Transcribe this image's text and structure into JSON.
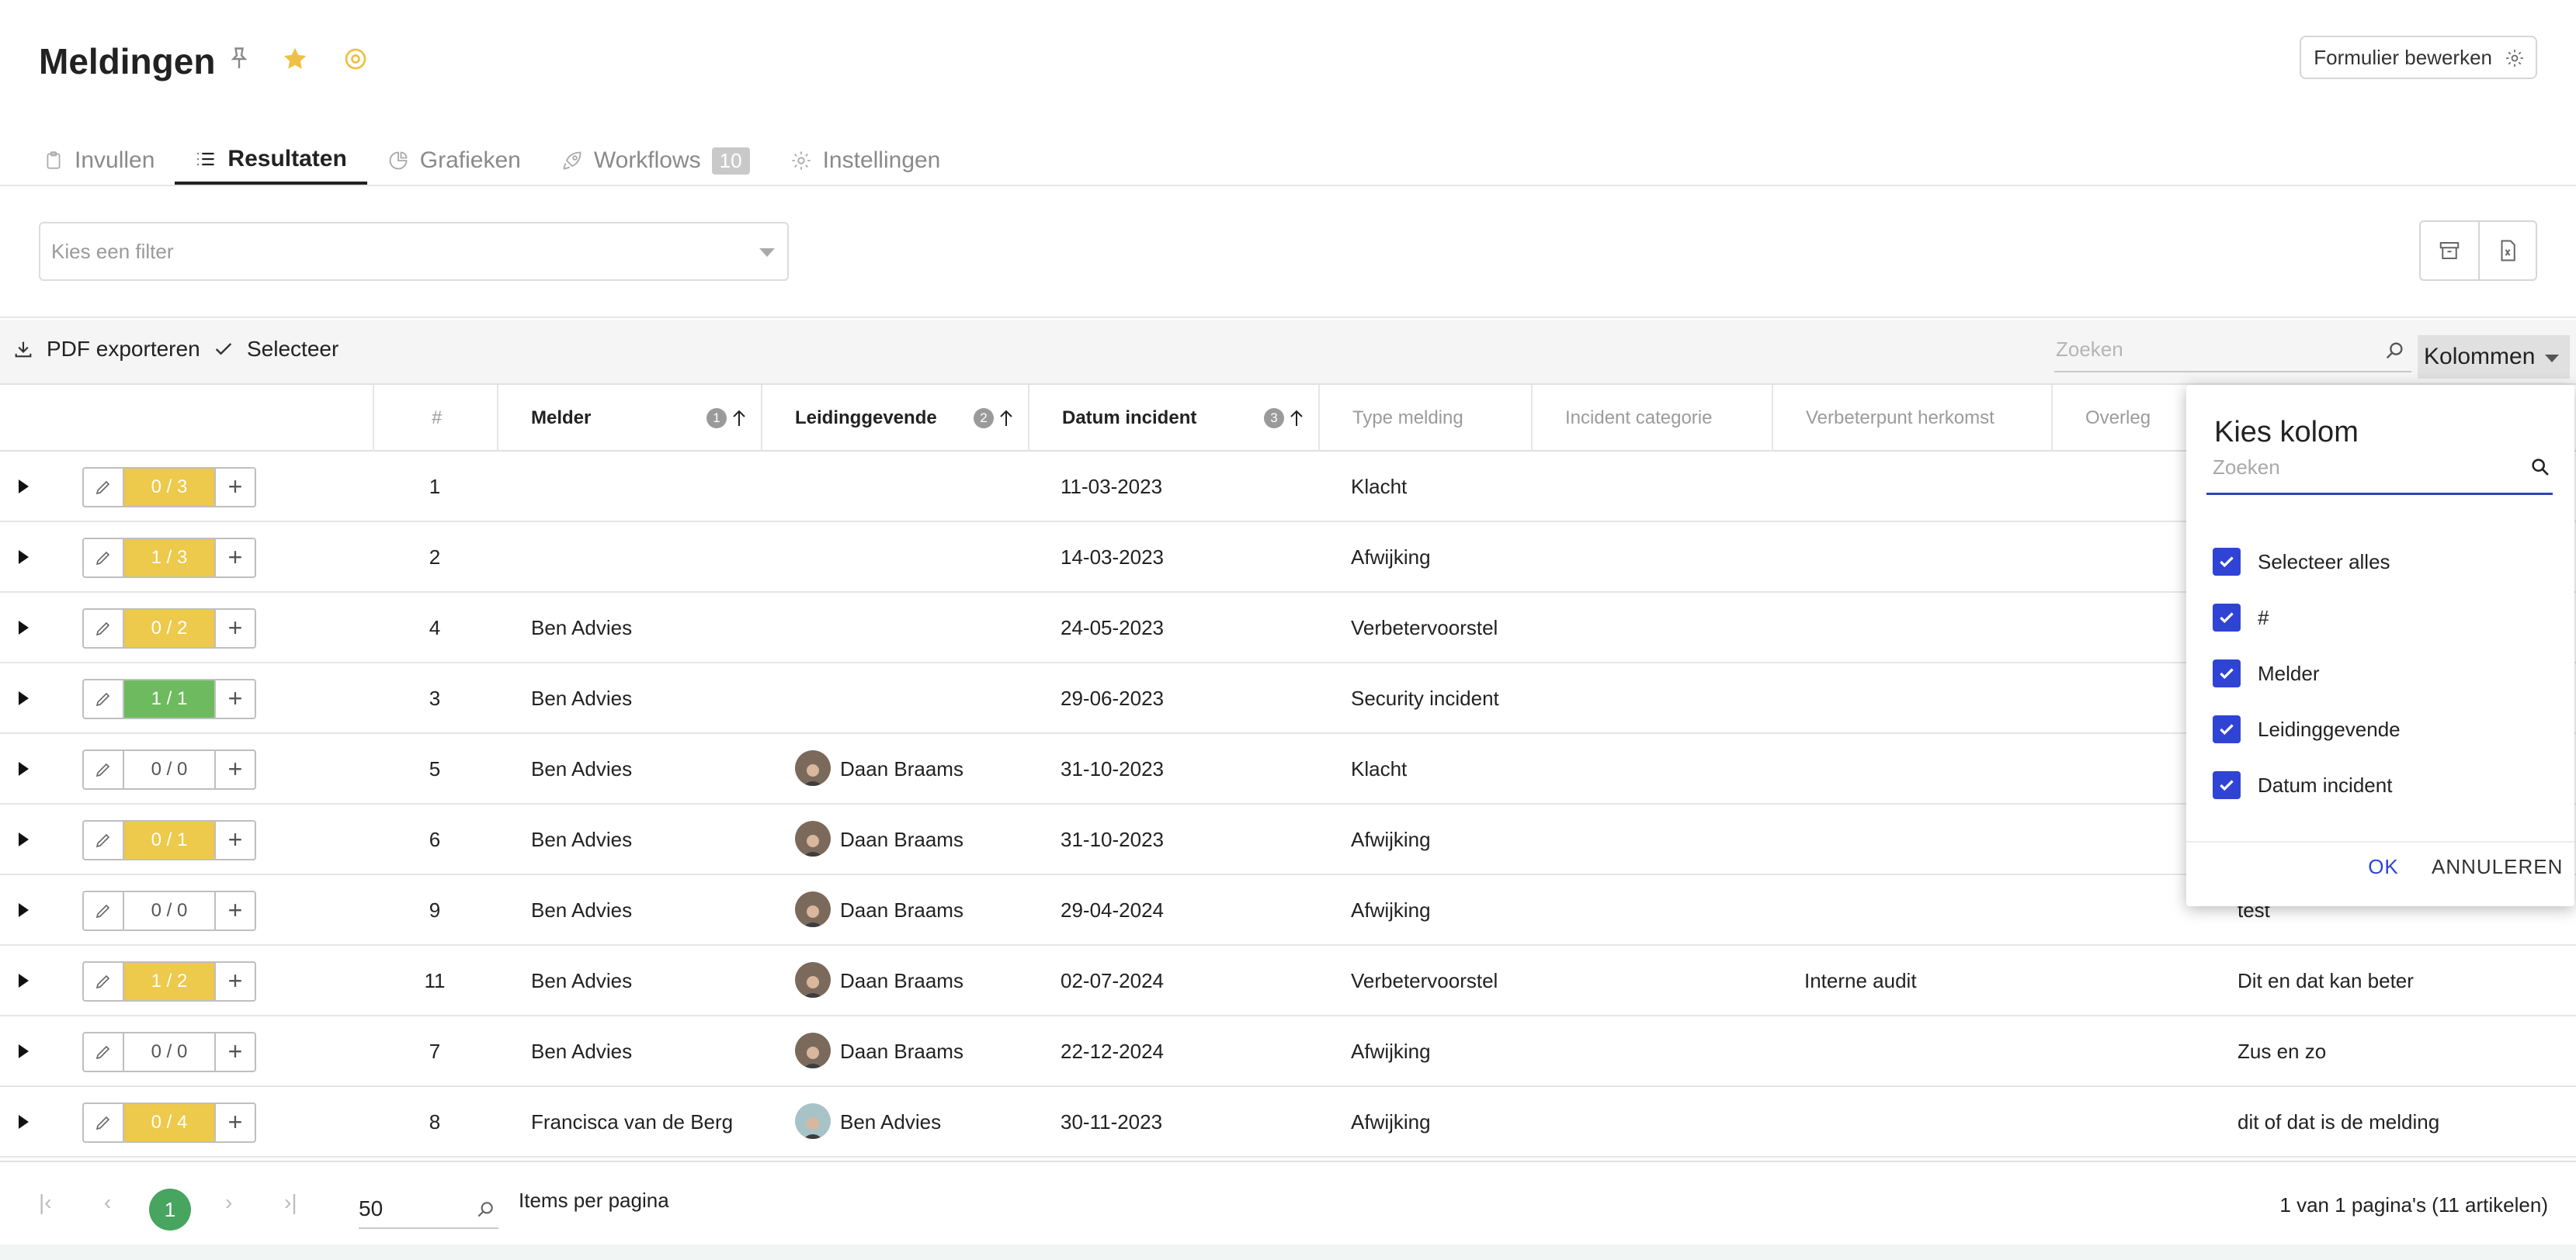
{
  "header": {
    "title": "Meldingen",
    "edit_form_label": "Formulier bewerken"
  },
  "tabs": [
    {
      "label": "Invullen",
      "icon": "clipboard-icon"
    },
    {
      "label": "Resultaten",
      "icon": "list-icon",
      "active": true
    },
    {
      "label": "Grafieken",
      "icon": "pie-chart-icon"
    },
    {
      "label": "Workflows",
      "icon": "rocket-icon",
      "badge": "10"
    },
    {
      "label": "Instellingen",
      "icon": "gear-icon"
    }
  ],
  "filter": {
    "placeholder": "Kies een filter"
  },
  "toolbar": {
    "pdf_label": "PDF exporteren",
    "select_label": "Selecteer",
    "search_placeholder": "Zoeken",
    "columns_label": "Kolommen"
  },
  "columns": [
    "#",
    "Melder",
    "Leidinggevende",
    "Datum incident",
    "Type melding",
    "Incident categorie",
    "Verbeterpunt herkomst",
    "Overleg"
  ],
  "sort": {
    "melder": "1",
    "leidinggevende": "2",
    "datum": "3"
  },
  "rows": [
    {
      "count": "0 / 3",
      "status": "yellow",
      "nr": "1",
      "melder": "",
      "leiding": "",
      "datum": "11-03-2023",
      "type": "Klacht",
      "herkomst": "",
      "extra": ""
    },
    {
      "count": "1 / 3",
      "status": "yellow",
      "nr": "2",
      "melder": "",
      "leiding": "",
      "datum": "14-03-2023",
      "type": "Afwijking",
      "herkomst": "",
      "extra": ""
    },
    {
      "count": "0 / 2",
      "status": "yellow",
      "nr": "4",
      "melder": "Ben Advies",
      "leiding": "",
      "datum": "24-05-2023",
      "type": "Verbetervoorstel",
      "herkomst": "",
      "extra": ""
    },
    {
      "count": "1 / 1",
      "status": "green",
      "nr": "3",
      "melder": "Ben Advies",
      "leiding": "",
      "datum": "29-06-2023",
      "type": "Security incident",
      "herkomst": "",
      "extra": ""
    },
    {
      "count": "0 / 0",
      "status": "none",
      "nr": "5",
      "melder": "Ben Advies",
      "leiding": "Daan Braams",
      "datum": "31-10-2023",
      "type": "Klacht",
      "herkomst": "",
      "extra": ""
    },
    {
      "count": "0 / 1",
      "status": "yellow",
      "nr": "6",
      "melder": "Ben Advies",
      "leiding": "Daan Braams",
      "datum": "31-10-2023",
      "type": "Afwijking",
      "herkomst": "",
      "extra": ""
    },
    {
      "count": "0 / 0",
      "status": "none",
      "nr": "9",
      "melder": "Ben Advies",
      "leiding": "Daan Braams",
      "datum": "29-04-2024",
      "type": "Afwijking",
      "herkomst": "",
      "extra": "test"
    },
    {
      "count": "1 / 2",
      "status": "yellow",
      "nr": "11",
      "melder": "Ben Advies",
      "leiding": "Daan Braams",
      "datum": "02-07-2024",
      "type": "Verbetervoorstel",
      "herkomst": "Interne audit",
      "extra": "Dit en dat kan beter"
    },
    {
      "count": "0 / 0",
      "status": "none",
      "nr": "7",
      "melder": "Ben Advies",
      "leiding": "Daan Braams",
      "datum": "22-12-2024",
      "type": "Afwijking",
      "herkomst": "",
      "extra": "Zus en zo"
    },
    {
      "count": "0 / 4",
      "status": "yellow",
      "nr": "8",
      "melder": "Francisca van de Berg",
      "leiding": "Ben Advies",
      "datum": "30-11-2023",
      "type": "Afwijking",
      "herkomst": "",
      "extra": "dit of dat is de melding"
    }
  ],
  "pagination": {
    "current_page": "1",
    "per_page": "50",
    "per_page_label": "Items per pagina",
    "info": "1 van 1 pagina's (11 artikelen)"
  },
  "column_picker": {
    "title": "Kies kolom",
    "search_placeholder": "Zoeken",
    "items": [
      "Selecteer alles",
      "#",
      "Melder",
      "Leidinggevende",
      "Datum incident"
    ],
    "ok_label": "OK",
    "cancel_label": "ANNULEREN"
  },
  "colors": {
    "accent": "#2f44d4",
    "partial": "#edc94c",
    "complete": "#6dbb5e",
    "page_active": "#48a560"
  }
}
